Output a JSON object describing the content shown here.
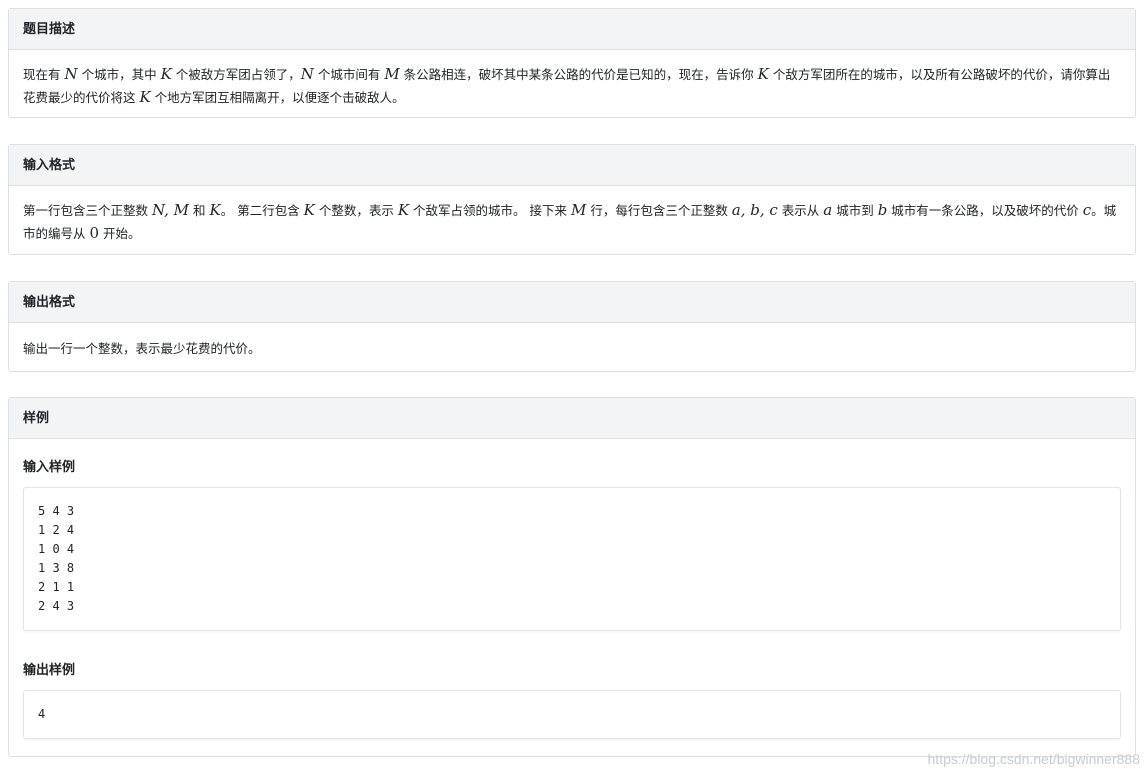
{
  "sections": {
    "description": {
      "title": "题目描述",
      "parts": [
        "现在有 ",
        "N",
        " 个城市，其中 ",
        "K",
        " 个被敌方军团占领了，",
        "N",
        " 个城市间有 ",
        "M",
        " 条公路相连，破坏其中某条公路的代价是已知的，现在，告诉你 ",
        "K",
        " 个敌方军团所在的城市，以及所有公路破坏的代价，请你算出花费最少的代价将这 ",
        "K",
        " 个地方军团互相隔离开，以便逐个击破敌人。"
      ]
    },
    "input_format": {
      "title": "输入格式",
      "parts": [
        "第一行包含三个正整数 ",
        "N, M",
        " 和 ",
        "K",
        "。 第二行包含 ",
        "K",
        " 个整数，表示 ",
        "K",
        " 个敌军占领的城市。 接下来 ",
        "M",
        " 行，每行包含三个正整数 ",
        "a, b, c",
        " 表示从 ",
        "a",
        " 城市到 ",
        "b",
        " 城市有一条公路，以及破坏的代价 ",
        "c",
        "。城市的编号从 ",
        "0",
        " 开始。"
      ]
    },
    "output_format": {
      "title": "输出格式",
      "text": "输出一行一个整数，表示最少花费的代价。"
    },
    "sample": {
      "title": "样例",
      "input_title": "输入样例",
      "input_text": "5 4 3\n1 2 4\n1 0 4\n1 3 8\n2 1 1\n2 4 3",
      "output_title": "输出样例",
      "output_text": "4"
    }
  },
  "watermark": "https://blog.csdn.net/bigwinner888"
}
